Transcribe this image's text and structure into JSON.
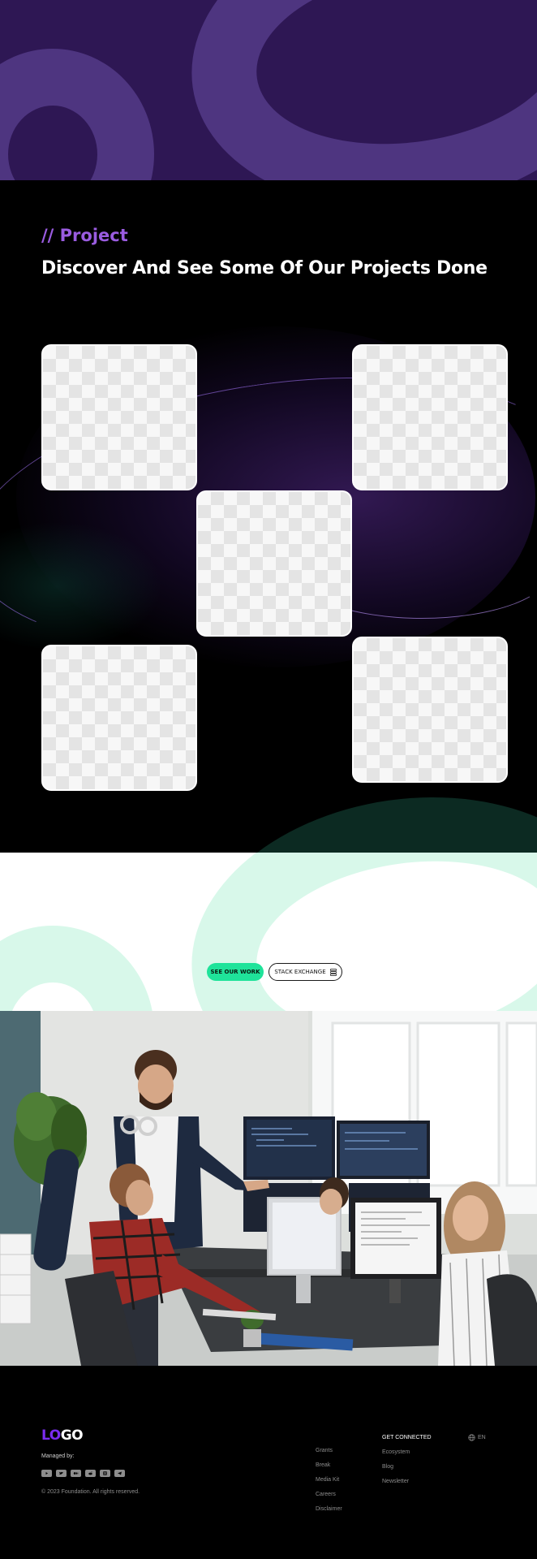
{
  "project": {
    "eyebrow": "// Project",
    "headline": "Discover And See Some Of Our Projects Done"
  },
  "cta": {
    "primary_label": "SEE OUR WORK",
    "secondary_label": "STACK EXCHANGE"
  },
  "footer": {
    "logo_accent": "LO",
    "logo_rest": "GO",
    "managed_by": "Managed by:",
    "socials": [
      "youtube-icon",
      "twitter-icon",
      "medium-icon",
      "reddit-icon",
      "instagram-icon",
      "telegram-icon"
    ],
    "copyright": "© 2023 Foundation. All rights reserved.",
    "links": [
      "Grants",
      "Break",
      "Media Kit",
      "Careers",
      "Disclaimer"
    ],
    "connect_heading": "GET CONNECTED",
    "connect_links": [
      "Ecosystem",
      "Blog",
      "Newsletter"
    ],
    "language": "EN"
  },
  "colors": {
    "hero_purple": "#2e1754",
    "accent_purple": "#9a5ce0",
    "logo_purple": "#7a2cf0",
    "cta_green": "#1fe39a"
  }
}
